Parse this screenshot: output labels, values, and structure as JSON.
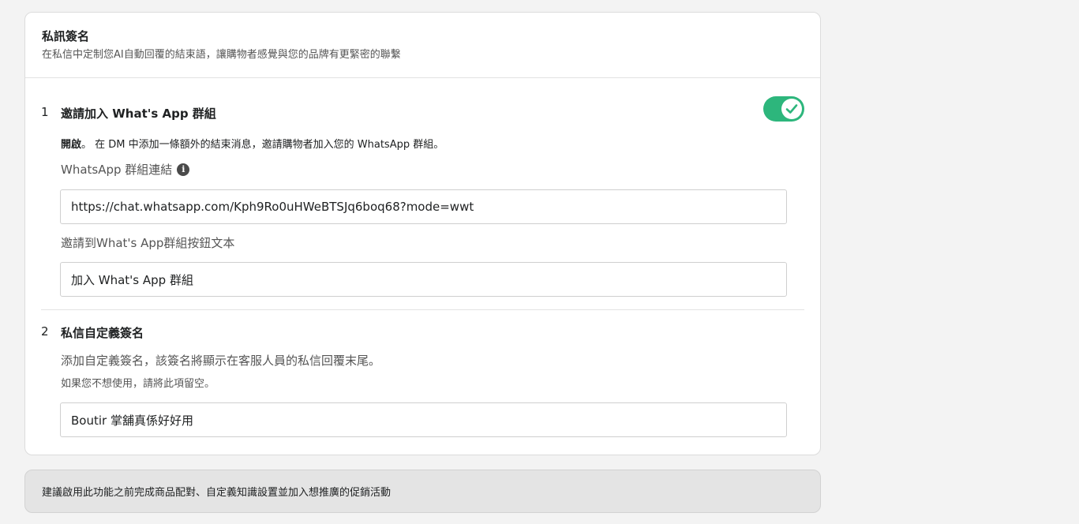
{
  "card": {
    "title": "私訊簽名",
    "subtitle": "在私信中定制您AI自動回覆的結束語，讓購物者感覺與您的品牌有更緊密的聯繫"
  },
  "section1": {
    "number": "1",
    "title": "邀請加入 What's App 群組",
    "toggle_on": true,
    "status_bold": "開啟",
    "status_text": "。 在 DM 中添加一條額外的結束消息，邀請購物者加入您的 WhatsApp 群組。",
    "link_label": "WhatsApp 群組連結",
    "link_value": "https://chat.whatsapp.com/Kph9Ro0uHWeBTSJq6boq68?mode=wwt",
    "button_text_label": "邀請到What's App群組按鈕文本",
    "button_text_value": "加入 What's App 群組"
  },
  "section2": {
    "number": "2",
    "title": "私信自定義簽名",
    "desc": "添加自定義簽名，該簽名將顯示在客服人員的私信回覆末尾。",
    "hint": "如果您不想使用，請將此項留空。",
    "signature_value": "Boutir 掌舖真係好好用"
  },
  "notice": {
    "text": "建議啟用此功能之前完成商品配對、自定義知識設置並加入想推廣的促銷活動"
  },
  "colors": {
    "toggle_on": "#2db67c",
    "background": "#f3f3f3"
  }
}
